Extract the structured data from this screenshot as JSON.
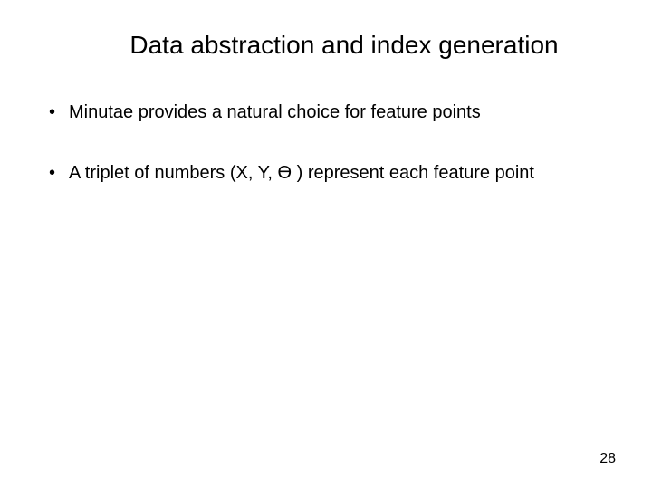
{
  "slide": {
    "title": "Data abstraction and index generation",
    "bullets": [
      "Minutae provides a natural choice for feature points",
      "A triplet of numbers (X, Y, Ө ) represent each feature point"
    ],
    "page_number": "28"
  }
}
